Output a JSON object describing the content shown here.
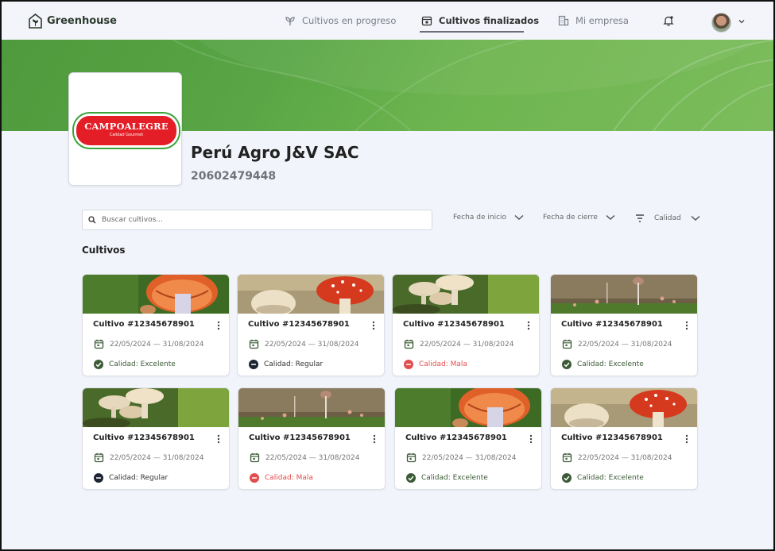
{
  "nav": {
    "brand": "Greenhouse",
    "items": [
      {
        "label": "Cultivos en progreso",
        "icon": "sprout-icon",
        "active": false
      },
      {
        "label": "Cultivos finalizados",
        "icon": "calendar-icon",
        "active": true
      },
      {
        "label": "Mi empresa",
        "icon": "building-icon",
        "active": false
      }
    ],
    "notifications_icon": "bell-icon"
  },
  "company": {
    "logo_text": "CAMPOALEGRE",
    "logo_tagline": "Calidad Gourmet",
    "name": "Perú Agro J&V SAC",
    "ruc": "20602479448"
  },
  "search": {
    "placeholder": "Buscar cultivos..."
  },
  "filters": {
    "start_date": "Fecha de inicio",
    "end_date": "Fecha de cierre",
    "quality": "Calidad"
  },
  "section_title": "Cultivos",
  "colors": {
    "brand_green": "#5aa646",
    "excelente": "#3b5a36",
    "regular": "#1d2433",
    "mala": "#e44d4d"
  },
  "cards": [
    {
      "title": "Cultivo #12345678901",
      "dates": "22/05/2024 — 31/08/2024",
      "quality": "Calidad: Excelente",
      "status": "excelente",
      "image": "orange-mushroom"
    },
    {
      "title": "Cultivo #12345678901",
      "dates": "22/05/2024 — 31/08/2024",
      "quality": "Calidad: Regular",
      "status": "regular",
      "image": "red-mushroom"
    },
    {
      "title": "Cultivo #12345678901",
      "dates": "22/05/2024 — 31/08/2024",
      "quality": "Calidad: Mala",
      "status": "mala",
      "image": "beige-mushrooms"
    },
    {
      "title": "Cultivo #12345678901",
      "dates": "22/05/2024 — 31/08/2024",
      "quality": "Calidad: Excelente",
      "status": "excelente",
      "image": "tiny-mushrooms"
    },
    {
      "title": "Cultivo #12345678901",
      "dates": "22/05/2024 — 31/08/2024",
      "quality": "Calidad: Regular",
      "status": "regular",
      "image": "beige-mushrooms"
    },
    {
      "title": "Cultivo #12345678901",
      "dates": "22/05/2024 — 31/08/2024",
      "quality": "Calidad: Mala",
      "status": "mala",
      "image": "tiny-mushrooms"
    },
    {
      "title": "Cultivo #12345678901",
      "dates": "22/05/2024 — 31/08/2024",
      "quality": "Calidad: Excelente",
      "status": "excelente",
      "image": "orange-mushroom"
    },
    {
      "title": "Cultivo #12345678901",
      "dates": "22/05/2024 — 31/08/2024",
      "quality": "Calidad: Excelente",
      "status": "excelente",
      "image": "red-mushroom"
    }
  ]
}
